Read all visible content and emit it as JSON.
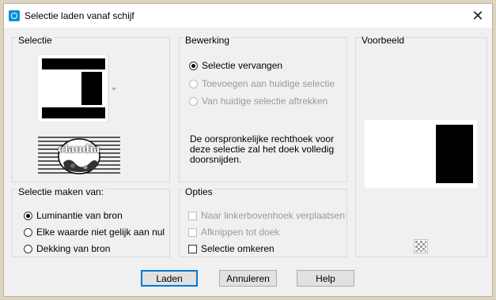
{
  "window": {
    "title": "Selectie laden vanaf schijf",
    "close_glyph": "✕"
  },
  "selectie": {
    "title": "Selectie",
    "thumbnail_label": "claudia"
  },
  "bewerking": {
    "title": "Bewerking",
    "options": [
      {
        "label": "Selectie vervangen",
        "checked": true,
        "enabled": true
      },
      {
        "label": "Toevoegen aan huidige selectie",
        "checked": false,
        "enabled": false
      },
      {
        "label": "Van huidige selectie aftrekken",
        "checked": false,
        "enabled": false
      }
    ],
    "note": "De oorspronkelijke rechthoek voor deze selectie zal het doek volledig doorsnijden."
  },
  "voorbeeld": {
    "title": "Voorbeeld"
  },
  "maken_van": {
    "title": "Selectie maken van:",
    "options": [
      {
        "label": "Luminantie van bron",
        "checked": true
      },
      {
        "label": "Elke waarde niet gelijk aan nul",
        "checked": false
      },
      {
        "label": "Dekking van bron",
        "checked": false
      }
    ]
  },
  "opties": {
    "title": "Opties",
    "items": [
      {
        "label": "Naar linkerbovenhoek verplaatsen",
        "checked": false,
        "enabled": false
      },
      {
        "label": "Afknippen tot doek",
        "checked": false,
        "enabled": false
      },
      {
        "label": "Selectie omkeren",
        "checked": false,
        "enabled": true
      }
    ]
  },
  "buttons": {
    "load": "Laden",
    "cancel": "Annuleren",
    "help": "Help"
  },
  "colors": {
    "default_button_border": "#0078d7",
    "disabled_text": "#9a9a9a"
  }
}
